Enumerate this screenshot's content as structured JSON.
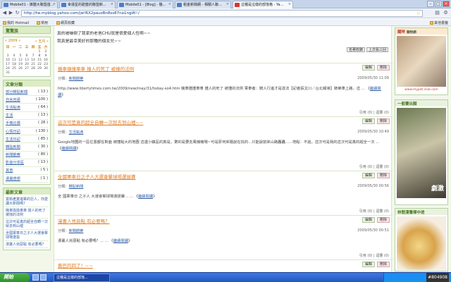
{
  "browser": {
    "tabs": [
      {
        "title": "Mobile01 - 媒體大聯盟首...",
        "active": false
      },
      {
        "title": "幸運星的甜蜜的聯盟新...",
        "active": false
      },
      {
        "title": "Mobile01 - [Blog] - 駱...",
        "active": false
      },
      {
        "title": "租金新聞網 - 相關人聯...",
        "active": false
      },
      {
        "title": "這種是這樣的部落格 - Ya...",
        "active": true
      }
    ],
    "url": "http://tw.myblog.yahoo.com/jw!RX2pausBn8ss87na1ngIA!-/",
    "bookmarks": [
      "我的 Hotmail",
      "常用",
      "網頁收藏"
    ],
    "bookmarks_right": "其他書籤"
  },
  "left": {
    "top_label": "驚驚族",
    "calendar": {
      "year_label": "« 2009 »",
      "month_label": "« 五月 »",
      "dow": [
        "日",
        "一",
        "二",
        "三",
        "四",
        "五",
        "六"
      ],
      "days": [
        "",
        "",
        "",
        "",
        "",
        "1",
        "2",
        "3",
        "4",
        "5",
        "6",
        "7",
        "8",
        "9",
        "10",
        "11",
        "12",
        "13",
        "14",
        "15",
        "16",
        "17",
        "18",
        "19",
        "20",
        "21",
        "22",
        "23",
        "24",
        "25",
        "26",
        "27",
        "28",
        "29",
        "30",
        "31",
        "",
        "",
        "",
        "",
        "",
        ""
      ]
    },
    "categories_title": "文章分類",
    "categories": [
      {
        "name": "部分轉貼新聞",
        "count": "( 13 )"
      },
      {
        "name": "自言自語",
        "count": "( 100 )"
      },
      {
        "name": "生活點滴",
        "count": "( 64 )"
      },
      {
        "name": "生活",
        "count": "( 13 )"
      },
      {
        "name": "手機比價",
        "count": "( 28 )"
      },
      {
        "name": "心情日記",
        "count": "( 130 )"
      },
      {
        "name": "生活日記",
        "count": "( 85 )"
      },
      {
        "name": "轉貼新聞",
        "count": "( 30 )"
      },
      {
        "name": "新聞觀察",
        "count": "( 80 )"
      },
      {
        "name": "影音分享區",
        "count": "( 13 )"
      },
      {
        "name": "其他",
        "count": "( 5 )"
      },
      {
        "name": "漫畫感想",
        "count": "( 1 )"
      }
    ],
    "recent_title": "最新文章",
    "recent": [
      "富衛產業進擊的巨人，你愛讀大新聞嗎？",
      "機車換換車車 撞人的死了 被撞的法例",
      "這次可是真的超全自轉一次就去到山裡",
      "全國軍車日之子人大選會擊球場選拔",
      "漫畫人兇惡點 有必要嗎？"
    ]
  },
  "main": {
    "intro_lines": [
      "真的被嚇倒了我家的老爸CHU就是很愛個人性啊~~",
      "我真是最幸美好的那種的個女兒~~"
    ],
    "top_actions": [
      "名著收錄",
      "上次看三回"
    ],
    "edit_label": "編輯",
    "delete_label": "刪除",
    "category_prefix": "分類：",
    "read_more": "繼續閱讀",
    "posts": [
      {
        "title": "機車撞撞車車 撞人的死了 被撞的法例",
        "category": "新聞觀察",
        "date": "2009/05/30 11:09",
        "body": "http://www.libertytimes.com.tw/2009/new/may/31/today-so4.htm 機車撞撞車車 撞人的死了 被撞的法例 軍車者：騎人行進才是違法【記者張文川／台北報導】騎單車上路，這",
        "stats": "引用 (0) | 迴響 (0)"
      },
      {
        "title": "這次可是真的超全自轉一次就去到山裡~~",
        "category": "生活點滴",
        "date": "2009/05/30 10:49",
        "body": "Google地圖的一區位置都在對面 被撞點大的地圖 這邊小鎮區的真是，驚的是要去風機機場~可是原何來隨說在找的...只能說前來山路轟轟......地點：不過，這次可是我的這次可是真的超全一次",
        "stats": "引用 (0) | 迴響 (0)"
      },
      {
        "title": "全國軍車日之子人大選會擊球場選拔賽",
        "category": "轉貼新聞",
        "date": "2009/05/30 00:56",
        "body": "全 國軍車日 之子人 大選會擊球場選拔賽...",
        "stats": "引用 (0) | 迴響 (0)"
      },
      {
        "title": "漫畫人兇惡點 有必要嗎？",
        "category": "新聞觀察",
        "date": "2009/05/30 00:51",
        "body": "漫畫人兇惡點 有必要嗎？...",
        "stats": "引用 (0) | 迴響 (0)"
      },
      {
        "title": "撕巴的四了！~~",
        "category": "",
        "date": "",
        "body": "",
        "stats": ""
      }
    ]
  },
  "right": {
    "ad1_title": "關咩",
    "ad1_sub": "寵物網",
    "ad1_footer": "www.mypet-club.com",
    "ad2_title": "一般賽出顏",
    "ad2_caption": "劇激",
    "ad3_title": "林閒漂鶯禪中途"
  },
  "taskbar": {
    "start_label": "開始",
    "task_label": "這種是這樣的部落...",
    "clock": "#804908"
  },
  "colors": {
    "accent_orange": "#e47a1e",
    "link_blue": "#3561a8",
    "panel_green": "#dcecc5"
  }
}
